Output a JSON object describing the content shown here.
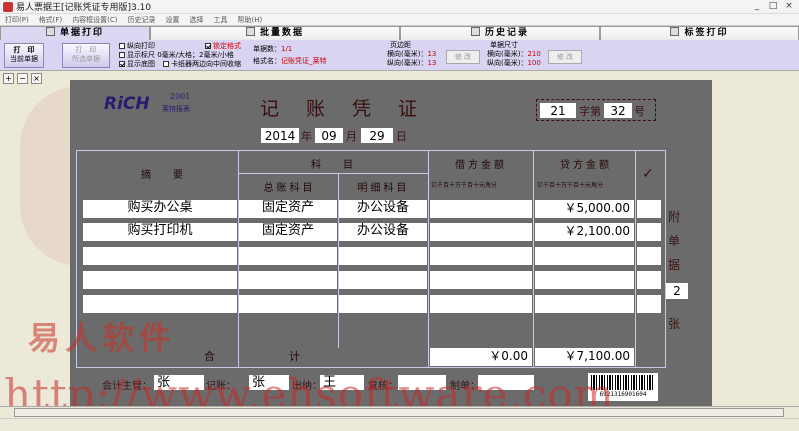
{
  "titlebar": {
    "title": "易人票据王[记账凭证专用版]3.10",
    "min": "_",
    "max": "□",
    "close": "×"
  },
  "menu": [
    "打印(P)",
    "格式(F)",
    "内容框设置(C)",
    "历史记录",
    "设置",
    "选择",
    "工具",
    "帮助(H)"
  ],
  "tabs": [
    "单据打印",
    "批量数据",
    "历史记录",
    "标签打印"
  ],
  "toolbar": {
    "print_label": "打　印",
    "print_sub": "当前单据",
    "batch_label": "打　印",
    "batch_sub": "所选单据",
    "cb_vertical": "纵向打印",
    "cb_ruler": "显示标尺  0毫米/大格；2毫米/小格",
    "cb_bg": "显示底图",
    "cb_card": "卡纸器两边向中间收缩",
    "cb_lock": "锁定格式",
    "pages_label": "单据数：",
    "pages_value": "1/1",
    "format_label": "格式名：",
    "format_value": "记账凭证_莱特",
    "margin_title": "页边距",
    "margin_h_label": "横向(毫米)：",
    "margin_h_value": "13",
    "margin_v_label": "纵向(毫米)：",
    "margin_v_value": "13",
    "margin_btn": "修 改",
    "size_title": "单据尺寸",
    "size_h_label": "横向(毫米)：",
    "size_h_value": "210",
    "size_v_label": "纵向(毫米)：",
    "size_v_value": "100",
    "size_btn": "修 改"
  },
  "voucher": {
    "logo": "RiCH",
    "logo_year": "2001",
    "logo_cn": "莱特报表",
    "title": "记　账　凭　证",
    "zi_value": "21",
    "zi_label": "字第",
    "hao_value": "32",
    "hao_label": "号",
    "year": "2014",
    "year_label": "年",
    "month": "09",
    "month_label": "月",
    "day": "29",
    "day_label": "日",
    "col_summary": "摘　要",
    "col_subject": "科　目",
    "col_general": "总账科目",
    "col_detail": "明细科目",
    "col_debit": "借方金额",
    "col_credit": "贷方金额",
    "digits": "亿千百十万千百十元角分",
    "check_mark": "✓",
    "rows": [
      {
        "summary": "购买办公桌",
        "general": "固定资产",
        "detail": "办公设备",
        "debit": "",
        "credit": "￥5,000.00"
      },
      {
        "summary": "购买打印机",
        "general": "固定资产",
        "detail": "办公设备",
        "debit": "",
        "credit": "￥2,100.00"
      },
      {
        "summary": "",
        "general": "",
        "detail": "",
        "debit": "",
        "credit": ""
      },
      {
        "summary": "",
        "general": "",
        "detail": "",
        "debit": "",
        "credit": ""
      },
      {
        "summary": "",
        "general": "",
        "detail": "",
        "debit": "",
        "credit": ""
      }
    ],
    "total_label": "合　　　　计",
    "total_debit": "￥0.00",
    "total_credit": "￥7,100.00",
    "attach_top": "附",
    "attach_mid1": "单",
    "attach_mid2": "据",
    "attach_count": "2",
    "attach_bottom": "张",
    "accountant_label": "会计主管：",
    "accountant": "张",
    "bookkeeper_label": "记账：",
    "bookkeeper": "张",
    "cashier_label": "出纳：",
    "cashier": "王",
    "reviewer_label": "复核：",
    "reviewer": "",
    "maker_label": "制单：",
    "maker": "",
    "barcode_text": "6921316901604"
  },
  "watermark": {
    "brand": "易人软件",
    "url": "http://www.ehsoftware.com"
  },
  "colors": {
    "toolbar_bg": "#d8d4f2",
    "voucher_bg": "#6b6b6b",
    "watermark": "#c83228"
  }
}
